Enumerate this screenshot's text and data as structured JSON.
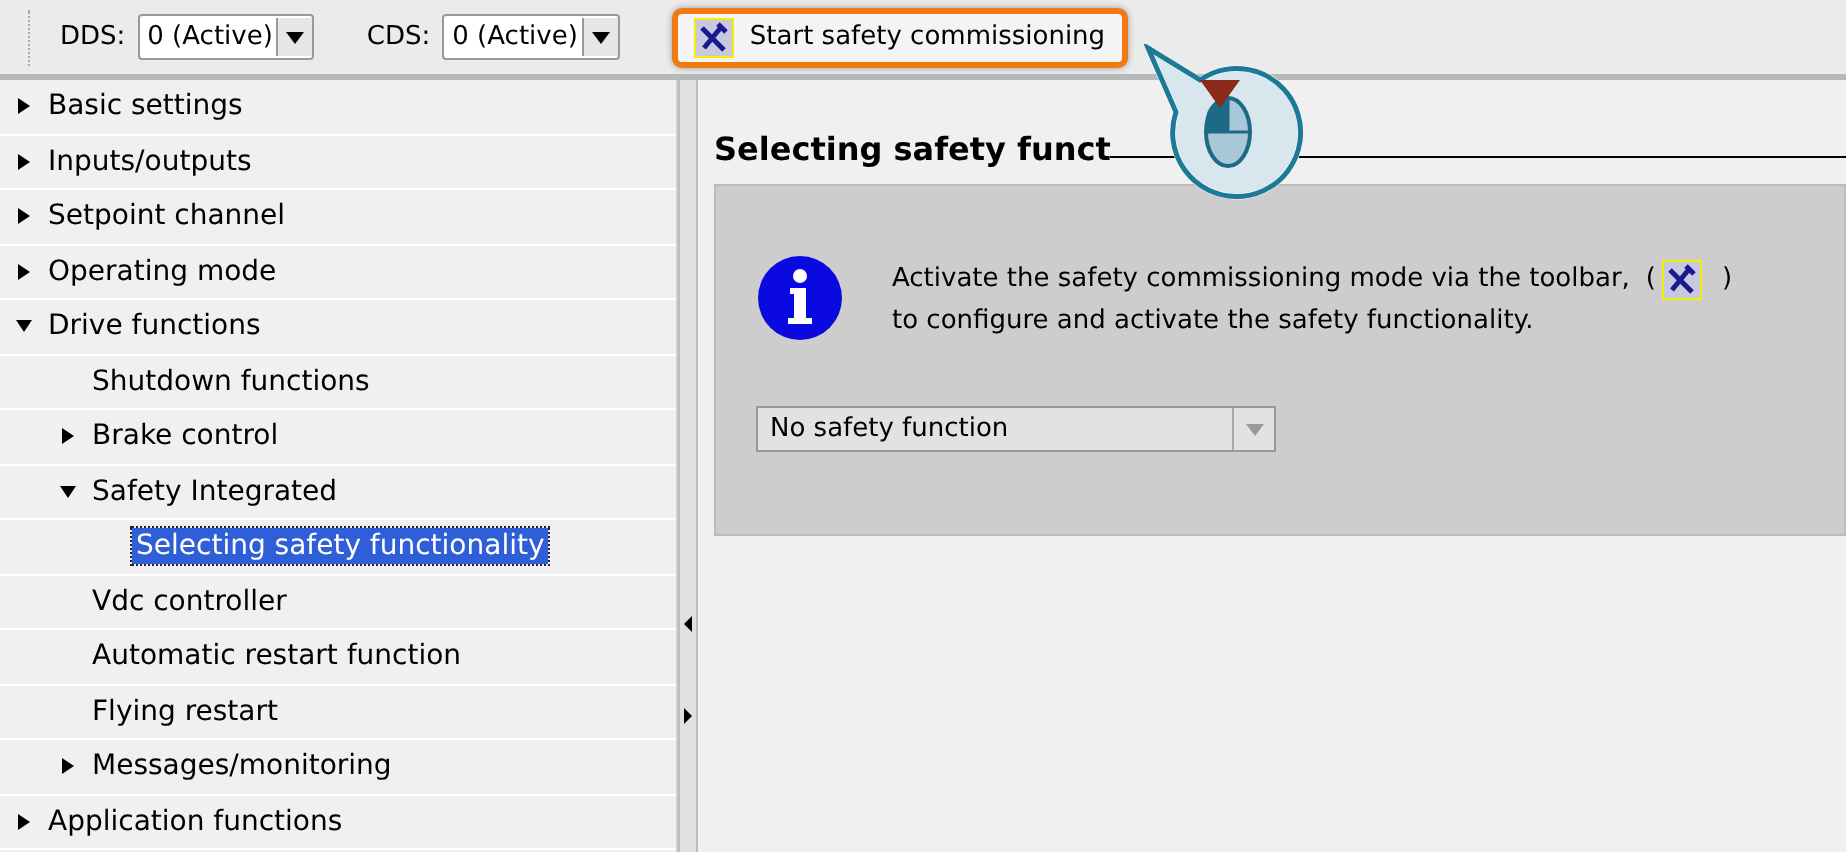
{
  "toolbar": {
    "dds": {
      "label": "DDS:",
      "value": "0 (Active)"
    },
    "cds": {
      "label": "CDS:",
      "value": "0 (Active)"
    },
    "commission_button": {
      "label": "Start safety commissioning",
      "highlighted": true
    }
  },
  "tree": [
    {
      "label": "Basic settings",
      "kind": "branch",
      "expanded": false,
      "selected": false
    },
    {
      "label": "Inputs/outputs",
      "kind": "branch",
      "expanded": false,
      "selected": false
    },
    {
      "label": "Setpoint channel",
      "kind": "branch",
      "expanded": false,
      "selected": false
    },
    {
      "label": "Operating mode",
      "kind": "branch",
      "expanded": false,
      "selected": false
    },
    {
      "label": "Drive functions",
      "kind": "branch",
      "expanded": true,
      "selected": false,
      "children": [
        {
          "label": "Shutdown functions",
          "kind": "leaf",
          "selected": false
        },
        {
          "label": "Brake control",
          "kind": "branch",
          "expanded": false,
          "selected": false
        },
        {
          "label": "Safety Integrated",
          "kind": "branch",
          "expanded": true,
          "selected": false,
          "children": [
            {
              "label": "Selecting safety functionality",
              "kind": "leaf",
              "selected": true
            }
          ]
        },
        {
          "label": "Vdc controller",
          "kind": "leaf",
          "selected": false
        },
        {
          "label": "Automatic restart function",
          "kind": "leaf",
          "selected": false
        },
        {
          "label": "Flying restart",
          "kind": "leaf",
          "selected": false
        },
        {
          "label": "Messages/monitoring",
          "kind": "branch",
          "expanded": false,
          "selected": false
        }
      ]
    },
    {
      "label": "Application functions",
      "kind": "branch",
      "expanded": false,
      "selected": false
    }
  ],
  "content": {
    "heading": "Selecting safety funct",
    "info": {
      "line_1": "Activate the safety commissioning mode via the toolbar,",
      "paren_open": "(",
      "paren_close": ")",
      "line_2": "to configure and activate the safety functionality."
    },
    "select": {
      "value": "No safety function"
    }
  }
}
